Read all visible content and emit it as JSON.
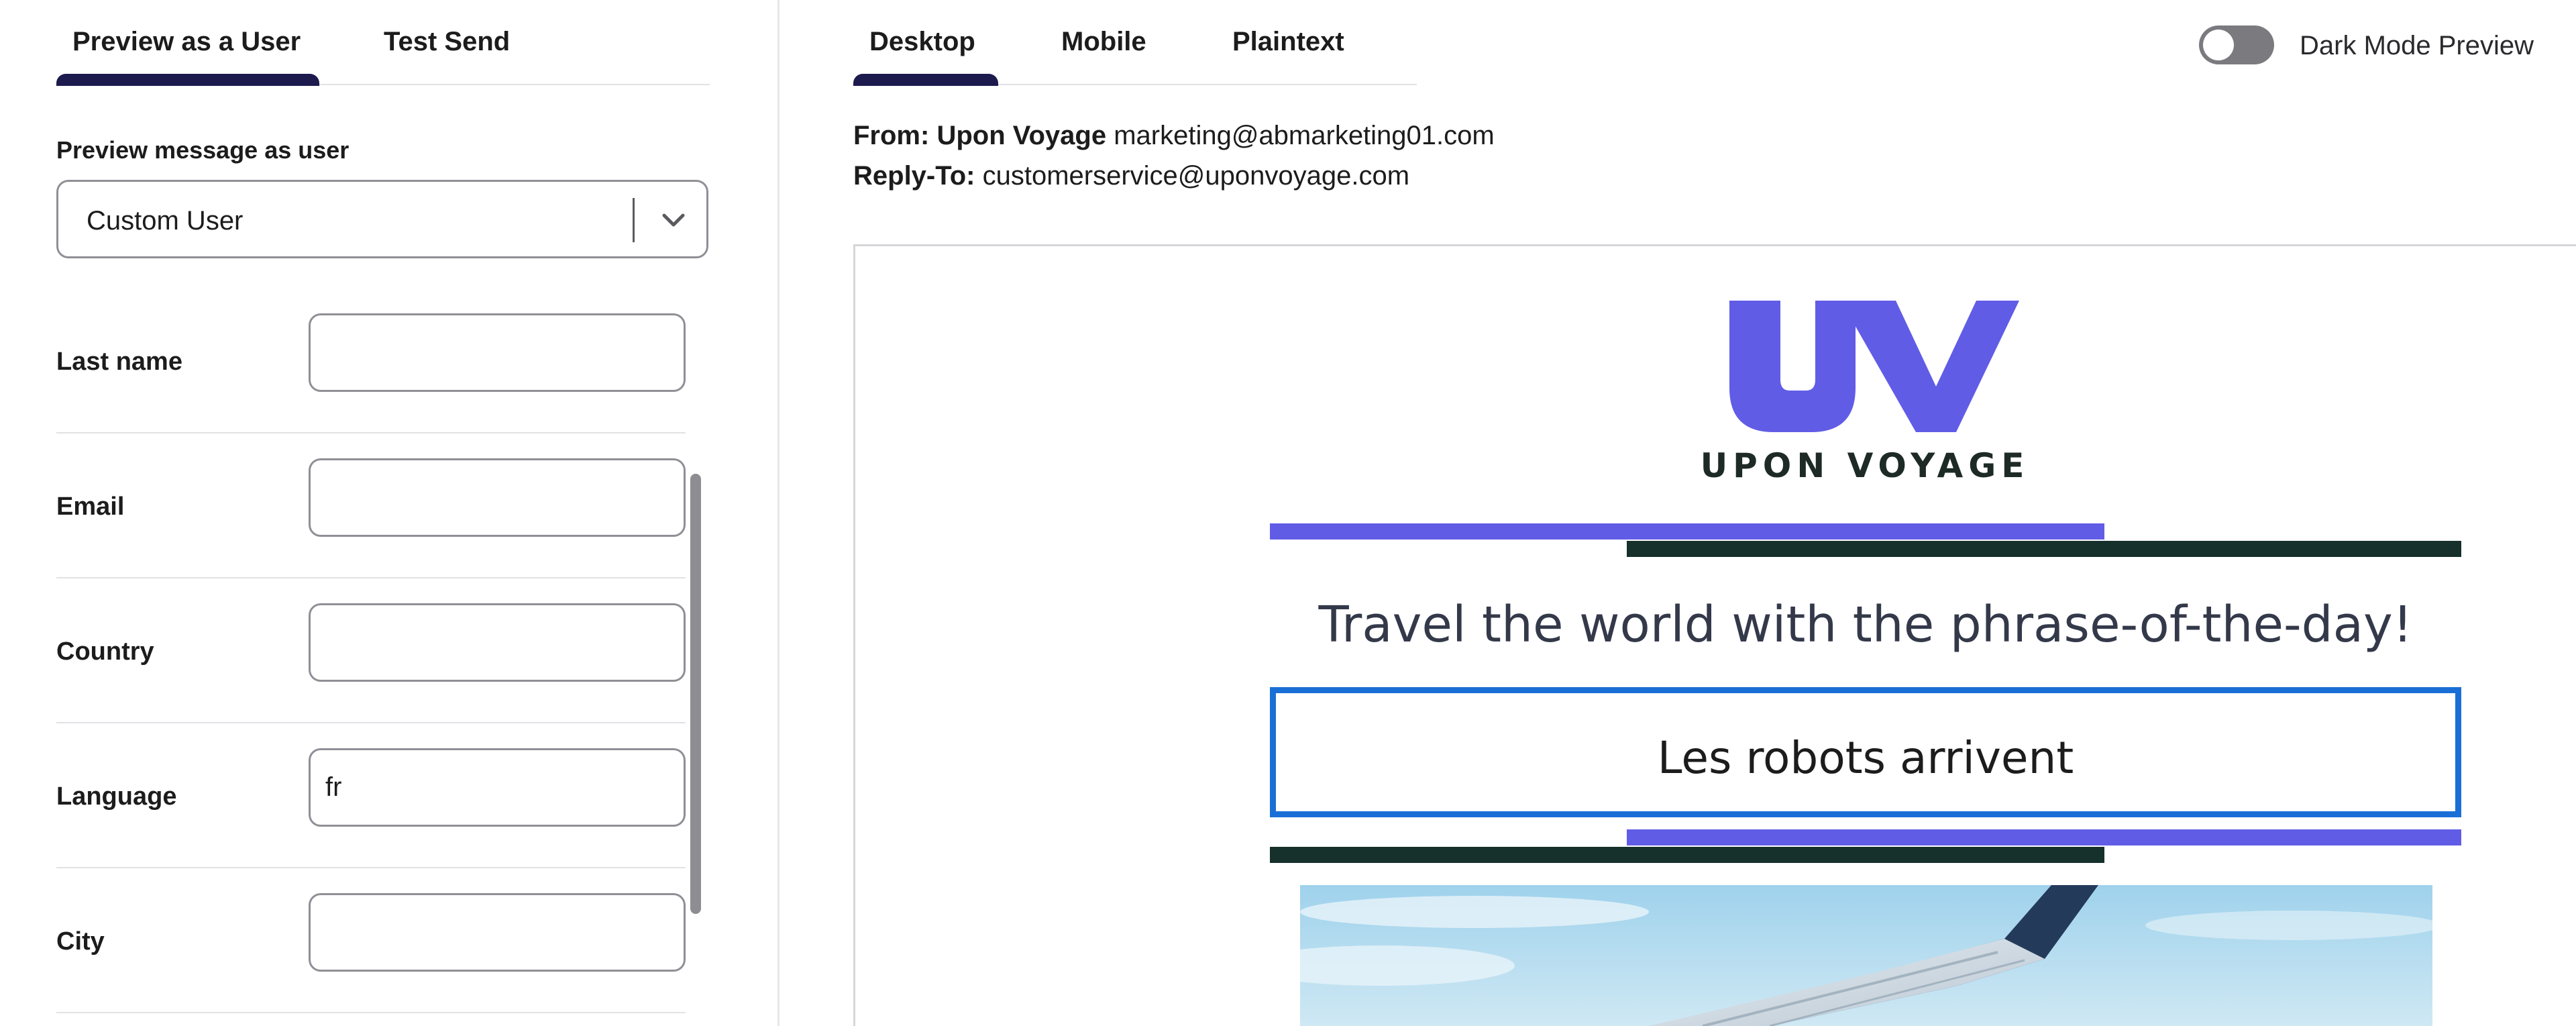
{
  "left_panel": {
    "tabs": [
      {
        "label": "Preview as a User",
        "active": true
      },
      {
        "label": "Test Send",
        "active": false
      }
    ],
    "preview_label": "Preview message as user",
    "user_select": {
      "value": "Custom User"
    },
    "fields": [
      {
        "label": "Last name",
        "value": ""
      },
      {
        "label": "Email",
        "value": ""
      },
      {
        "label": "Country",
        "value": ""
      },
      {
        "label": "Language",
        "value": "fr"
      },
      {
        "label": "City",
        "value": ""
      }
    ]
  },
  "right_panel": {
    "tabs": [
      {
        "label": "Desktop",
        "active": true
      },
      {
        "label": "Mobile",
        "active": false
      },
      {
        "label": "Plaintext",
        "active": false
      }
    ],
    "dark_mode": {
      "label": "Dark Mode Preview",
      "enabled": false
    },
    "from": {
      "prefix": "From:",
      "name": "Upon Voyage",
      "address": "marketing@abmarketing01.com"
    },
    "reply_to": {
      "prefix": "Reply-To:",
      "address": "customerservice@uponvoyage.com"
    }
  },
  "email": {
    "brand_name": "UPON VOYAGE",
    "headline": "Travel the world with the phrase-of-the-day!",
    "phrase": "Les robots arrivent",
    "colors": {
      "brand_purple": "#615ce6",
      "brand_dark": "#16302b",
      "phrase_border": "#1a6fd6",
      "tab_active": "#1d1a4e"
    },
    "hero_image": "airplane-wing-sky"
  }
}
